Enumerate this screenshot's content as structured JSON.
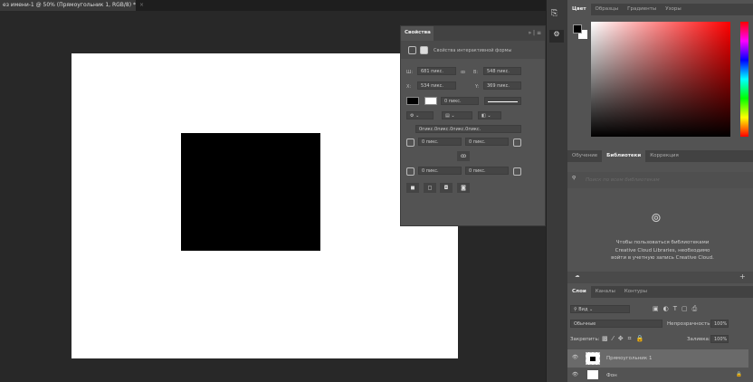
{
  "document": {
    "tab_title": "ез имени-1 @ 50% (Прямоугольник 1, RGB/8) *",
    "close": "×"
  },
  "properties": {
    "title": "Свойства",
    "menu": "» | ≡",
    "subtitle": "Свойства интерактивной формы",
    "w_label": "Ш:",
    "w": "681 пикс.",
    "link": "ꝏ",
    "h_label": "В:",
    "h": "548 пикс.",
    "x_label": "X:",
    "x": "534 пикс.",
    "y_label": "Y:",
    "y": "369 пикс.",
    "stroke_width": "0 пикс.",
    "corners_all": "0пикс.0пикс.0пикс.0пикс.",
    "c_tl": "0 пикс.",
    "c_tr": "0 пикс.",
    "c_bl": "0 пикс.",
    "c_br": "0 пикс."
  },
  "color_panel": {
    "tabs": [
      "Цвет",
      "Образцы",
      "Градиенты",
      "Узоры"
    ],
    "fg": "#000000",
    "bg": "#ffffff"
  },
  "libraries_panel": {
    "tabs": [
      "Обучение",
      "Библиотеки",
      "Коррекция"
    ],
    "search_placeholder": "Поиск по всем библиотекам",
    "message": "Чтобы пользоваться библиотеками Creative Cloud Libraries, необходимо войти в учетную запись Creative Cloud."
  },
  "layers_panel": {
    "tabs": [
      "Слои",
      "Каналы",
      "Контуры"
    ],
    "filter": "Вид",
    "blend": "Обычные",
    "opacity_label": "Непрозрачность:",
    "opacity": "100%",
    "lock_label": "Закрепить:",
    "fill_label": "Заливка:",
    "fill": "100%",
    "layers": [
      {
        "name": "Прямоугольник 1"
      },
      {
        "name": "Фон"
      }
    ]
  }
}
